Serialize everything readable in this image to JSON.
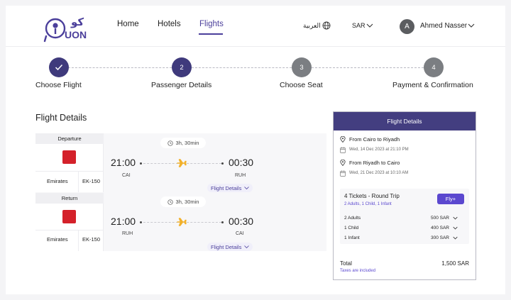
{
  "brand": {
    "logo_text": "كو",
    "logo_sub": "UON",
    "color": "#4b3f9b"
  },
  "nav": {
    "items": [
      {
        "label": "Home",
        "active": false
      },
      {
        "label": "Hotels",
        "active": false
      },
      {
        "label": "Flights",
        "active": true
      }
    ]
  },
  "header": {
    "language": "العربية",
    "language_icon": "globe-icon",
    "currency": "SAR",
    "user": {
      "initial": "A",
      "name": "Ahmed Nasser"
    }
  },
  "steps": [
    {
      "number": "",
      "label": "Choose Flight",
      "state": "done",
      "icon": "check-icon"
    },
    {
      "number": "2",
      "label": "Passenger Details",
      "state": "current"
    },
    {
      "number": "3",
      "label": "Seat",
      "state": "todo",
      "full_label": "Choose Seat"
    },
    {
      "number": "4",
      "label": "Payment & Confirmation",
      "state": "todo"
    }
  ],
  "flight_details": {
    "title": "Flight Details",
    "legs": [
      {
        "head": "Departure",
        "airline": "Emirates",
        "flight_no": "EK-150",
        "duration": "3h, 30min",
        "depart_time": "21:00",
        "arrive_time": "00:30",
        "from_code": "CAI",
        "to_code": "RUH",
        "details_link": "Flight Details"
      },
      {
        "head": "Return",
        "airline": "Emirates",
        "flight_no": "EK-150",
        "duration": "3h, 30min",
        "depart_time": "21:00",
        "arrive_time": "00:30",
        "from_code": "RUH",
        "to_code": "CAI",
        "details_link": "Flight Details"
      }
    ]
  },
  "summary": {
    "title": "Flight Details",
    "routes": [
      {
        "label": "From Cairo to Riyadh",
        "date": "Wed, 14 Dec 2023 at 21:10 PM"
      },
      {
        "label": "From Riyadh to Cairo",
        "date": "Wed, 21 Dec 2023 at 10:10 AM"
      }
    ],
    "tickets_title": "4 Tickets - Round Trip",
    "tickets_sub": "2 Adults, 1 Child, 1 Infant",
    "fly_button": "Fly+",
    "passengers": [
      {
        "label": "2 Adults",
        "price": "500 SAR"
      },
      {
        "label": "1 Child",
        "price": "400 SAR"
      },
      {
        "label": "1 Infant",
        "price": "300 SAR"
      }
    ],
    "total_label": "Total",
    "total_value": "1,500 SAR",
    "tax_note": "Taxes are included"
  },
  "colors": {
    "primary": "#433e80",
    "accent": "#5b48cf",
    "plane": "#f2b12b",
    "airline_red": "#d4212a"
  }
}
